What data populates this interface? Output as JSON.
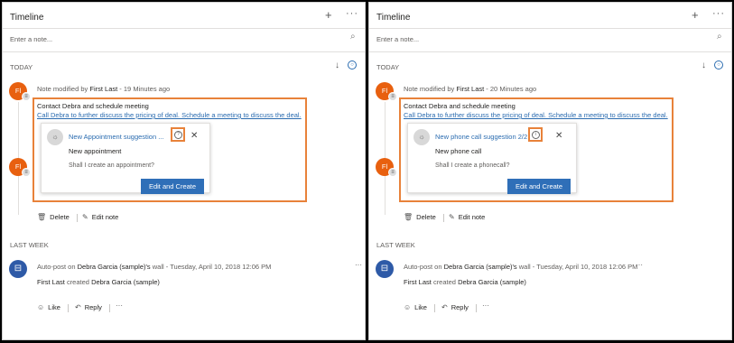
{
  "panels": [
    {
      "title": "Timeline",
      "note_placeholder": "Enter a note...",
      "today_label": "TODAY",
      "lastweek_label": "LAST WEEK",
      "avatar_initials": "Fl",
      "activity": {
        "modified_prefix": "Note modified by",
        "author": "First Last",
        "time": "19 Minutes ago",
        "subject": "Contact Debra and schedule meeting",
        "body": "Call Debra to further discuss the pricing of deal. Schedule a meeting to discuss the deal."
      },
      "suggestion": {
        "title": "New Appointment suggestion ...",
        "subtitle": "New appointment",
        "question": "Shall I create an appointment?",
        "button": "Edit and Create"
      },
      "actions": {
        "delete": "Delete",
        "edit": "Edit note"
      },
      "post": {
        "prefix": "Auto-post on",
        "wall": "Debra Garcia (sample)'s",
        "wall_suffix": "wall",
        "time": "Tuesday, April 10, 2018 12:06 PM",
        "body_author": "First Last",
        "body_verb": "created",
        "body_target": "Debra Garcia (sample)",
        "like": "Like",
        "reply": "Reply"
      }
    },
    {
      "title": "Timeline",
      "note_placeholder": "Enter a note...",
      "today_label": "TODAY",
      "lastweek_label": "LAST WEEK",
      "avatar_initials": "Fl",
      "activity": {
        "modified_prefix": "Note modified by",
        "author": "First Last",
        "time": "20 Minutes ago",
        "subject": "Contact Debra and schedule meeting",
        "body": "Call Debra to further discuss the pricing of deal. Schedule a meeting to discuss the deal."
      },
      "suggestion": {
        "title": "New phone call suggestion 2/2",
        "subtitle": "New phone call",
        "question": "Shall I create a phonecall?",
        "button": "Edit and Create"
      },
      "actions": {
        "delete": "Delete",
        "edit": "Edit note"
      },
      "post": {
        "prefix": "Auto-post on",
        "wall": "Debra Garcia (sample)'s",
        "wall_suffix": "wall",
        "time": "Tuesday, April 10, 2018 12:06 PM",
        "body_author": "First Last",
        "body_verb": "created",
        "body_target": "Debra Garcia (sample)",
        "like": "Like",
        "reply": "Reply"
      }
    }
  ],
  "colors": {
    "accent": "#2f6fb8",
    "highlight": "#e8823a",
    "avatar": "#e8600f",
    "post_avatar": "#2e5aa7"
  },
  "icons": [
    "add-icon",
    "more-icon",
    "paperclip-icon",
    "sort-down-icon",
    "filter-icon",
    "lightbulb-icon",
    "info-icon",
    "close-icon",
    "trash-icon",
    "pencil-icon",
    "like-icon",
    "reply-icon",
    "post-icon"
  ]
}
